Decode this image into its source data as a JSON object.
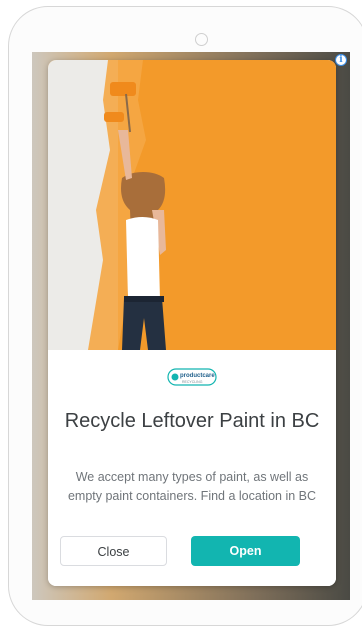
{
  "ad": {
    "adchoices_icon": "info-icon",
    "image_description_icon": "woman-painting-wall-orange",
    "advertiser_logo": {
      "text": "productcare",
      "subtext": "RECYCLING"
    },
    "headline": "Recycle Leftover Paint in BC",
    "body": "We accept many types of paint, as well as empty paint containers. Find a location in BC",
    "buttons": {
      "close_label": "Close",
      "open_label": "Open"
    }
  },
  "colors": {
    "paint_orange": "#f39a2a",
    "open_button": "#12b5b0",
    "headline_text": "#3c4043",
    "body_text": "#70757a"
  }
}
